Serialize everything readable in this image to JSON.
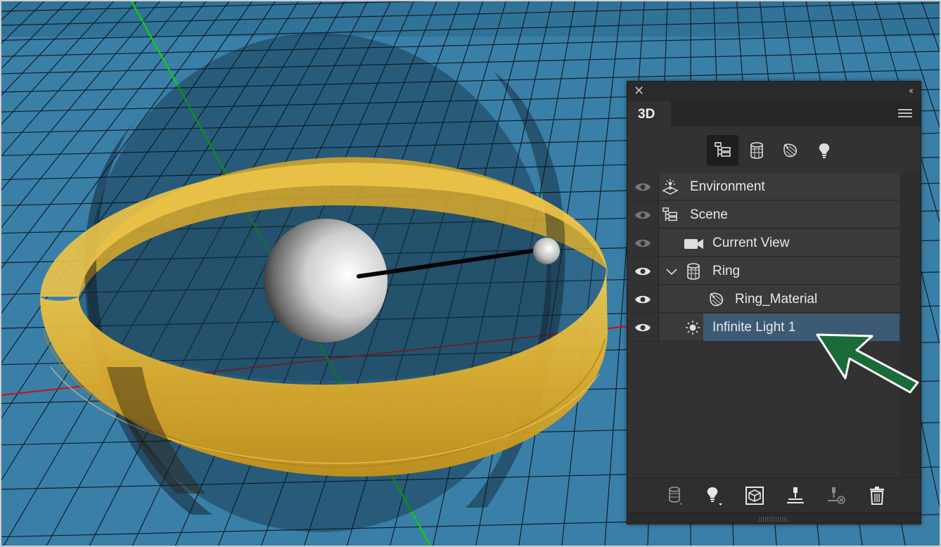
{
  "panel": {
    "close_glyph": "✕",
    "collapse_glyph": "‹‹",
    "tab_label": "3D",
    "filters": [
      {
        "name": "whole-scene-filter",
        "icon": "scene-tree-icon",
        "active": true
      },
      {
        "name": "meshes-filter",
        "icon": "mesh-icon",
        "active": false
      },
      {
        "name": "materials-filter",
        "icon": "material-icon",
        "active": false
      },
      {
        "name": "lights-filter",
        "icon": "light-bulb-icon",
        "active": false
      }
    ],
    "layers": [
      {
        "label": "Environment",
        "icon": "environment-icon",
        "visible": true,
        "eye_dim": true
      },
      {
        "label": "Scene",
        "icon": "scene-tree-icon",
        "visible": true,
        "eye_dim": true
      },
      {
        "label": "Current View",
        "icon": "camera-icon",
        "visible": true,
        "eye_dim": true
      },
      {
        "label": "Ring",
        "icon": "mesh-icon",
        "visible": true,
        "eye_dim": false,
        "expanded": true
      },
      {
        "label": "Ring_Material",
        "icon": "material-icon",
        "visible": true,
        "eye_dim": false
      },
      {
        "label": "Infinite Light 1",
        "icon": "sun-light-icon",
        "visible": true,
        "eye_dim": false,
        "selected": true
      }
    ],
    "bottom_tools": [
      {
        "name": "add-mesh-button",
        "icon": "mesh-icon"
      },
      {
        "name": "add-light-button",
        "icon": "light-bulb-icon"
      },
      {
        "name": "render-button",
        "icon": "cube-icon"
      },
      {
        "name": "drop-to-ground-button",
        "icon": "ground-plane-icon"
      },
      {
        "name": "remove-constraint-button",
        "icon": "constraint-remove-icon"
      },
      {
        "name": "delete-button",
        "icon": "trash-icon"
      }
    ]
  },
  "colors": {
    "ground": "#3a7fa8",
    "grid_line": "#10202a",
    "ring_gold": "#e8b830",
    "selection": "#3d5a75",
    "arrow_green": "#1a6b3a",
    "x_axis": "#d01010",
    "y_axis": "#12c812"
  }
}
